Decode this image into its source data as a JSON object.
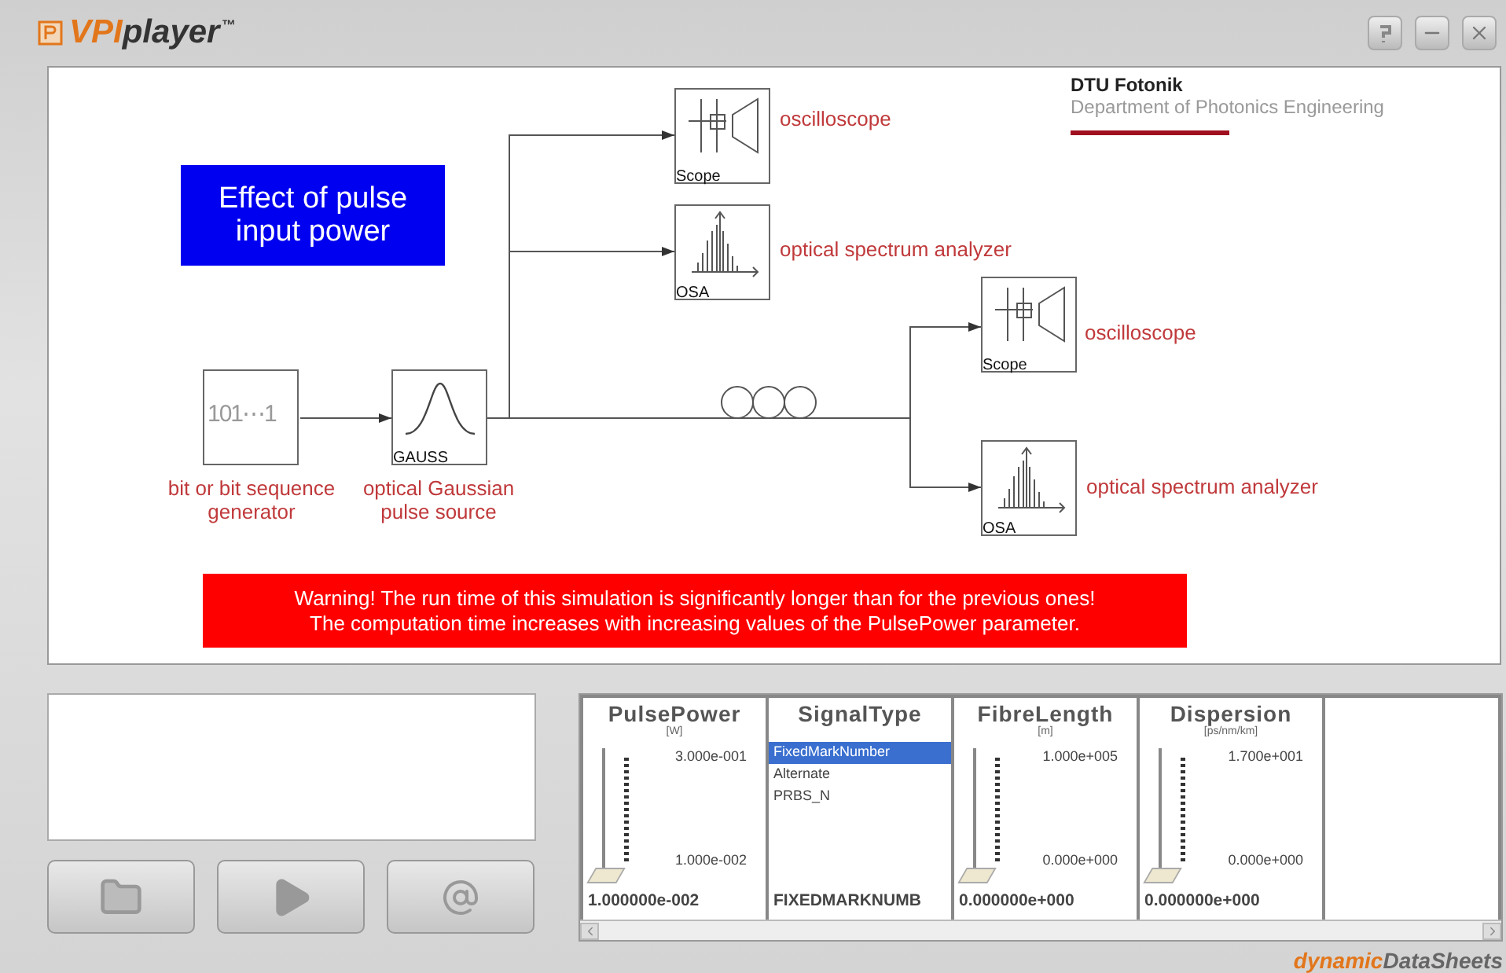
{
  "window": {
    "logo": {
      "brand": "VPI",
      "product": "player",
      "mark": "™"
    }
  },
  "diagram": {
    "title": "Effect of pulse input power",
    "org": {
      "name": "DTU Fotonik",
      "department": "Department of Photonics Engineering"
    },
    "blocks": [
      {
        "kind": "generator",
        "tag": "101⋯1",
        "label": "bit or bit sequence generator"
      },
      {
        "kind": "gauss",
        "tag": "GAUSS",
        "label": "optical Gaussian pulse source"
      },
      {
        "kind": "scope",
        "tag": "Scope",
        "label": "oscilloscope"
      },
      {
        "kind": "osa",
        "tag": "OSA",
        "label": "optical spectrum analyzer"
      },
      {
        "kind": "scope",
        "tag": "Scope",
        "label": "oscilloscope"
      },
      {
        "kind": "osa",
        "tag": "OSA",
        "label": "optical spectrum analyzer"
      }
    ],
    "warning": [
      "Warning! The run time of this simulation is significantly longer than for the previous ones!",
      "The computation time increases with increasing values of the PulsePower parameter."
    ]
  },
  "parameters": [
    {
      "kind": "slider",
      "name": "PulsePower",
      "unit": "[W]",
      "max": "3.000e-001",
      "min": "1.000e-002",
      "level": 0,
      "value": "1.000000e-002"
    },
    {
      "kind": "list",
      "name": "SignalType",
      "options": [
        {
          "label": "FixedMarkNumber",
          "selected": true
        },
        {
          "label": "Alternate",
          "selected": false
        },
        {
          "label": "PRBS_N",
          "selected": false
        }
      ],
      "value": "FIXEDMARKNUMB"
    },
    {
      "kind": "slider",
      "name": "FibreLength",
      "unit": "[m]",
      "max": "1.000e+005",
      "min": "0.000e+000",
      "level": 0,
      "value": "0.000000e+000"
    },
    {
      "kind": "slider",
      "name": "Dispersion",
      "unit": "[ps/nm/km]",
      "max": "1.700e+001",
      "min": "0.000e+000",
      "level": 0,
      "value": "0.000000e+000"
    }
  ],
  "footer": {
    "brand": "dynamic",
    "product": "DataSheets"
  }
}
